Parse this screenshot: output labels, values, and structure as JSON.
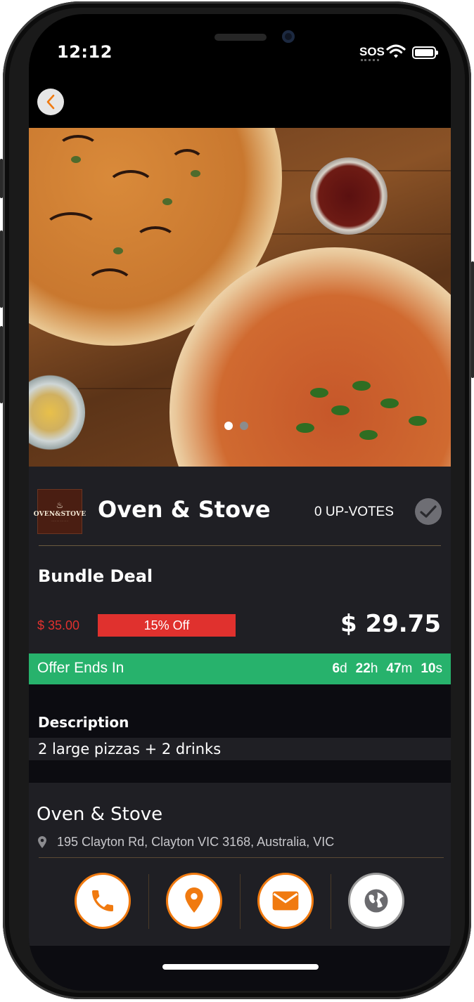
{
  "status_bar": {
    "time": "12:12",
    "sos": "SOS"
  },
  "hero": {
    "slide_count": 2,
    "active_slide": 0,
    "dot_active_color": "#ffffff",
    "dot_inactive_color": "#8c8c8c"
  },
  "store": {
    "logo_text": "OVEN&STOVE",
    "name": "Oven & Stove",
    "upvotes_label": "0 UP-VOTES"
  },
  "deal": {
    "title": "Bundle Deal",
    "old_price": "$ 35.00",
    "discount": "15% Off",
    "new_price": "$ 29.75"
  },
  "offer": {
    "label": "Offer Ends In",
    "days": "6",
    "days_unit": "d",
    "hours": "22",
    "hours_unit": "h",
    "minutes": "47",
    "minutes_unit": "m",
    "seconds": "10",
    "seconds_unit": "s"
  },
  "description": {
    "title": "Description",
    "text": "2 large pizzas + 2 drinks"
  },
  "location": {
    "name": "Oven & Stove",
    "address": "195 Clayton Rd, Clayton VIC 3168, Australia, VIC"
  },
  "actions": [
    {
      "icon": "phone-icon"
    },
    {
      "icon": "map-pin-icon"
    },
    {
      "icon": "mail-icon"
    },
    {
      "icon": "globe-icon"
    }
  ],
  "colors": {
    "accent": "#f07a10",
    "sale_red": "#e0312e",
    "offer_green": "#27b26c",
    "panel": "#1f1f24",
    "panel_dark": "#0c0c11"
  }
}
